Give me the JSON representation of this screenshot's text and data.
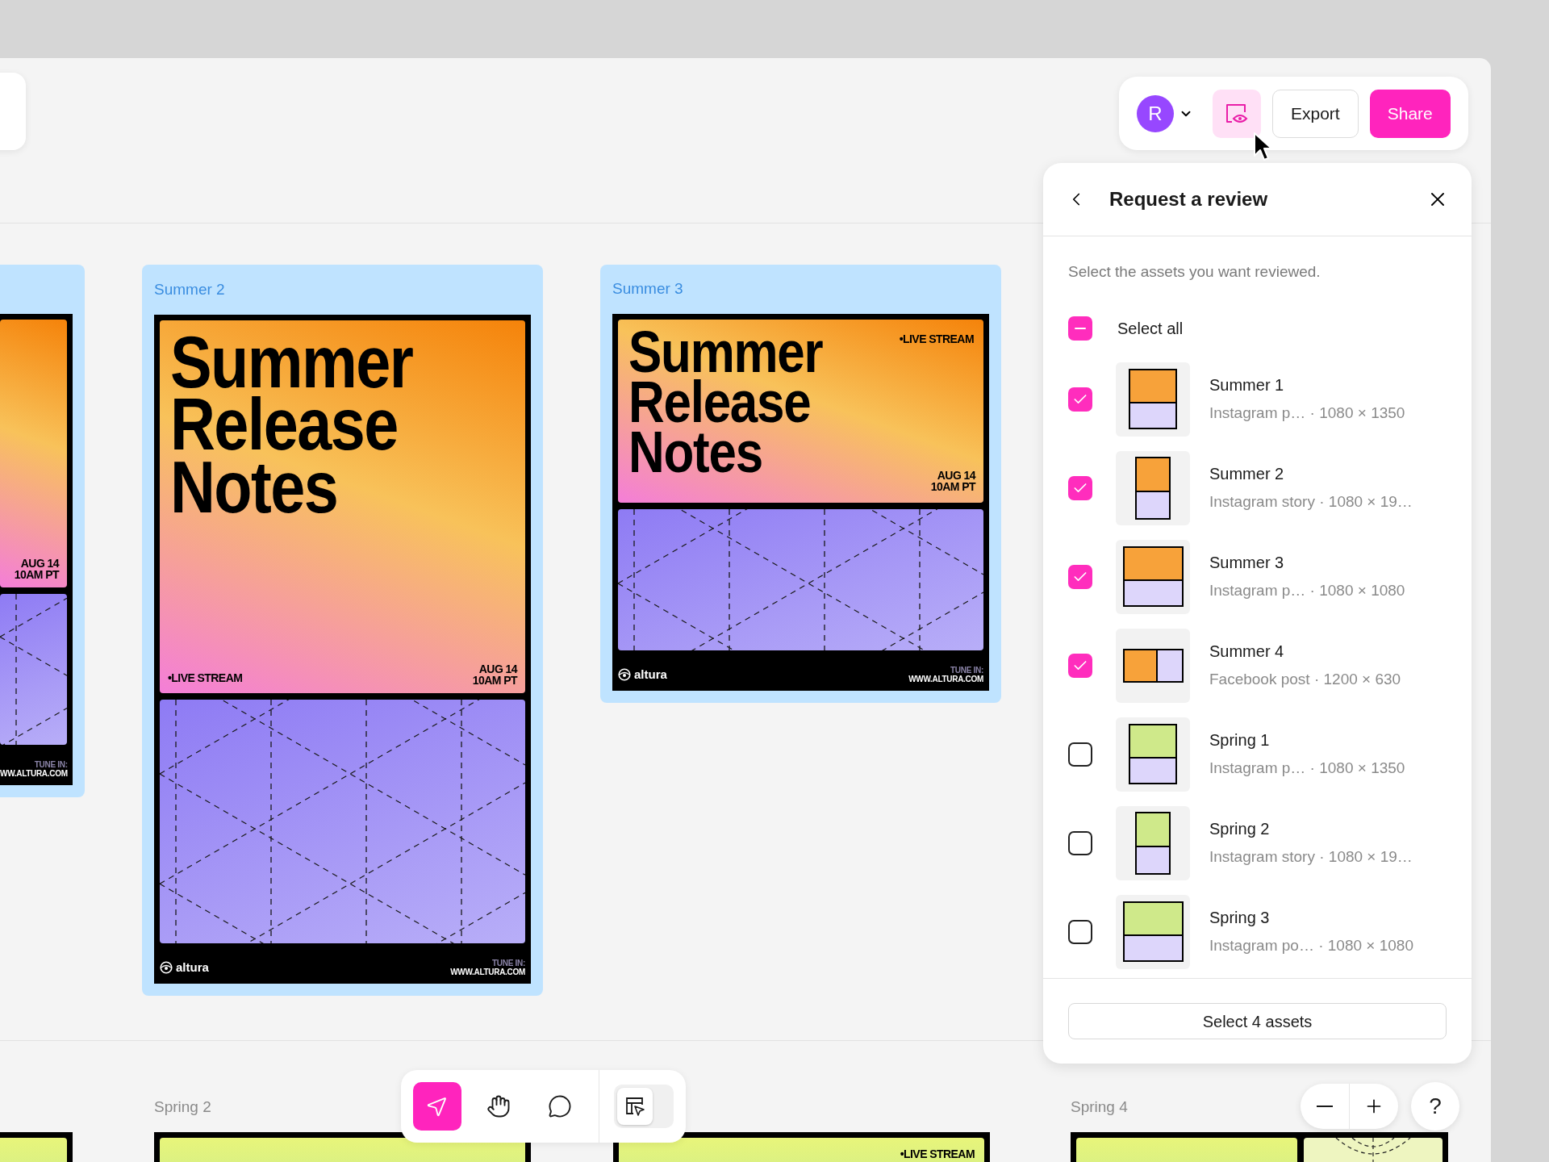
{
  "topbar": {
    "avatar": "R",
    "review": {
      "selected": true
    },
    "buttons": [
      {
        "kind": "secondary",
        "label": "Export"
      },
      {
        "kind": "primary",
        "label": "Share"
      }
    ]
  },
  "frames": [
    {
      "kind": "cropped",
      "selected": true,
      "poster": {
        "date": [
          "AUG 14",
          "10AM PT"
        ],
        "tune_in": "TUNE IN:",
        "url": "WW.ALTURA.COM"
      }
    },
    {
      "kind": "story",
      "selected": true,
      "label": "Summer 2",
      "poster": {
        "title": [
          "Summer",
          "Release",
          "Notes"
        ],
        "tag": "•LIVE STREAM",
        "date": [
          "AUG 14",
          "10AM PT"
        ],
        "brand": "altura",
        "tune_in": "TUNE IN:",
        "url": "WWW.ALTURA.COM"
      }
    },
    {
      "kind": "square",
      "selected": true,
      "label": "Summer 3",
      "poster": {
        "title": [
          "Summer",
          "Release",
          "Notes"
        ],
        "tag": "•LIVE STREAM",
        "date": [
          "AUG 14",
          "10AM PT"
        ],
        "brand": "altura",
        "tune_in": "TUNE IN:",
        "url": "WWW.ALTURA.COM"
      }
    }
  ],
  "lower_frames": [
    {
      "kind": "cropped"
    },
    {
      "kind": "story",
      "label": "Spring 2"
    },
    {
      "kind": "square",
      "tag": "•LIVE STREAM"
    },
    {
      "kind": "wide",
      "label": "Spring 4"
    }
  ],
  "panel": {
    "title": "Request a review",
    "subtitle": "Select the assets you want reviewed.",
    "select_all": {
      "label": "Select all",
      "indeterminate": true
    },
    "assets": [
      {
        "name": "Summer 1",
        "meta": "Instagram p… · 1080 × 1350",
        "checked": true,
        "color": "#f7a23a",
        "kind": "portrait"
      },
      {
        "name": "Summer 2",
        "meta": "Instagram story · 1080 × 19…",
        "checked": true,
        "color": "#f7a23a",
        "kind": "story"
      },
      {
        "name": "Summer 3",
        "meta": "Instagram p… · 1080 × 1080",
        "checked": true,
        "color": "#f7a23a",
        "kind": "square"
      },
      {
        "name": "Summer 4",
        "meta": "Facebook post · 1200 × 630",
        "checked": true,
        "color": "#f7a23a",
        "kind": "wide"
      },
      {
        "name": "Spring 1",
        "meta": "Instagram p… · 1080 × 1350",
        "checked": false,
        "color": "#cfe98a",
        "kind": "portrait"
      },
      {
        "name": "Spring 2",
        "meta": "Instagram story · 1080 × 19…",
        "checked": false,
        "color": "#cfe98a",
        "kind": "story"
      },
      {
        "name": "Spring 3",
        "meta": "Instagram po… · 1080 × 1080",
        "checked": false,
        "color": "#cfe98a",
        "kind": "square"
      }
    ],
    "footer_button": "Select 4 assets"
  },
  "tools": [
    {
      "kind": "pointer",
      "selected": true
    },
    {
      "kind": "hand",
      "selected": false
    },
    {
      "kind": "comment",
      "selected": false
    }
  ],
  "view_toggle": {
    "selected": true
  },
  "zoom": {
    "help": "?"
  }
}
